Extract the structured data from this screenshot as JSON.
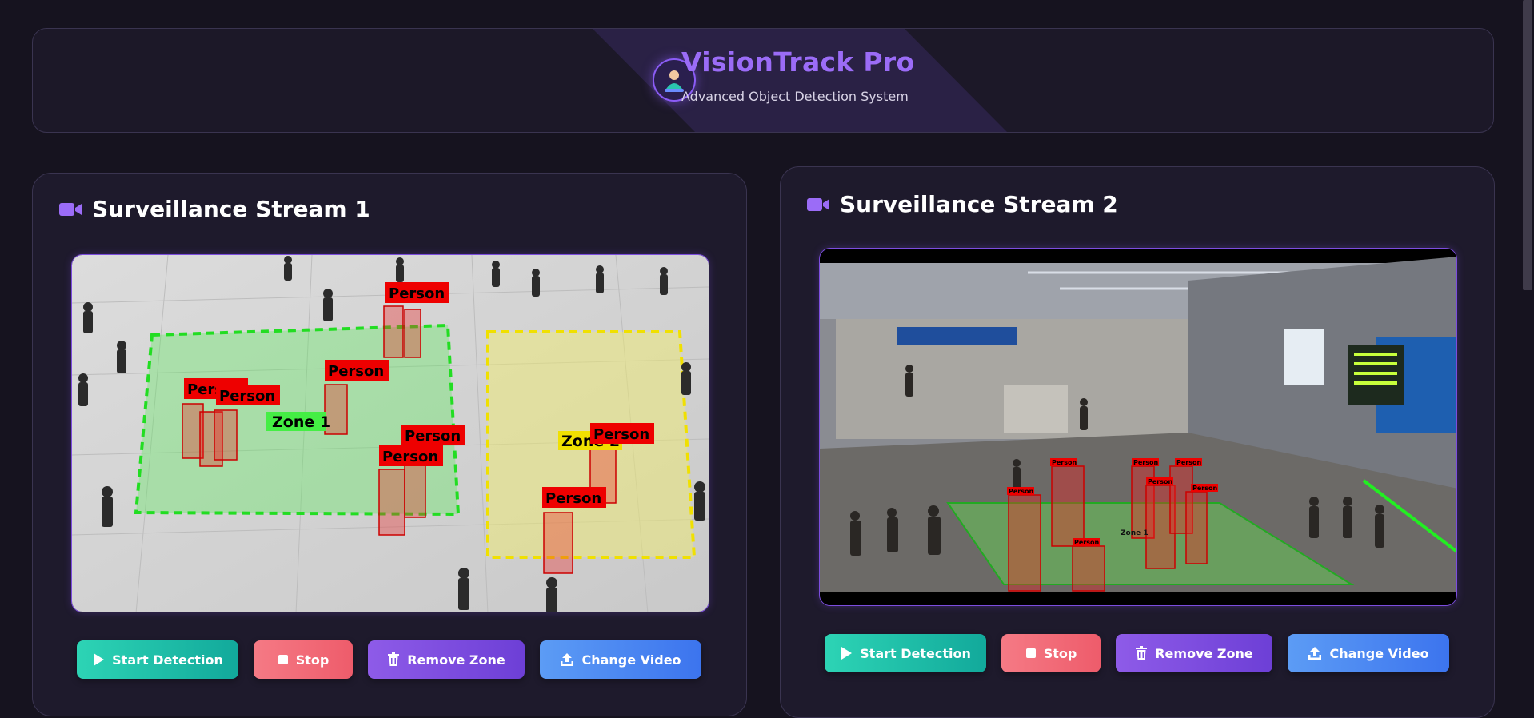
{
  "header": {
    "title": "VisionTrack Pro",
    "subtitle": "Advanced Object Detection System"
  },
  "streams": [
    {
      "title": "Surveillance Stream 1",
      "zones": [
        "Zone 1",
        "Zone 2"
      ],
      "detection_label": "Person",
      "buttons": {
        "start": "Start Detection",
        "stop": "Stop",
        "remove_zone": "Remove Zone",
        "change_video": "Change Video"
      }
    },
    {
      "title": "Surveillance Stream 2",
      "zones": [
        "Zone 1"
      ],
      "detection_label": "Person",
      "buttons": {
        "start": "Start Detection",
        "stop": "Stop",
        "remove_zone": "Remove Zone",
        "change_video": "Change Video"
      }
    }
  ],
  "colors": {
    "background": "#16131f",
    "accent": "#8b5cf6",
    "start": "#2dd4b5",
    "stop": "#f26b78",
    "remove": "#7c4dde",
    "change": "#4a86f2",
    "zone_green": "#22dd22",
    "zone_yellow": "#f0e000",
    "detection_red": "#ee0000"
  },
  "icons": {
    "logo": "person-scan-icon",
    "camera": "video-camera-icon",
    "start": "play-icon",
    "stop": "stop-square-icon",
    "remove": "trash-icon",
    "change": "upload-icon"
  }
}
